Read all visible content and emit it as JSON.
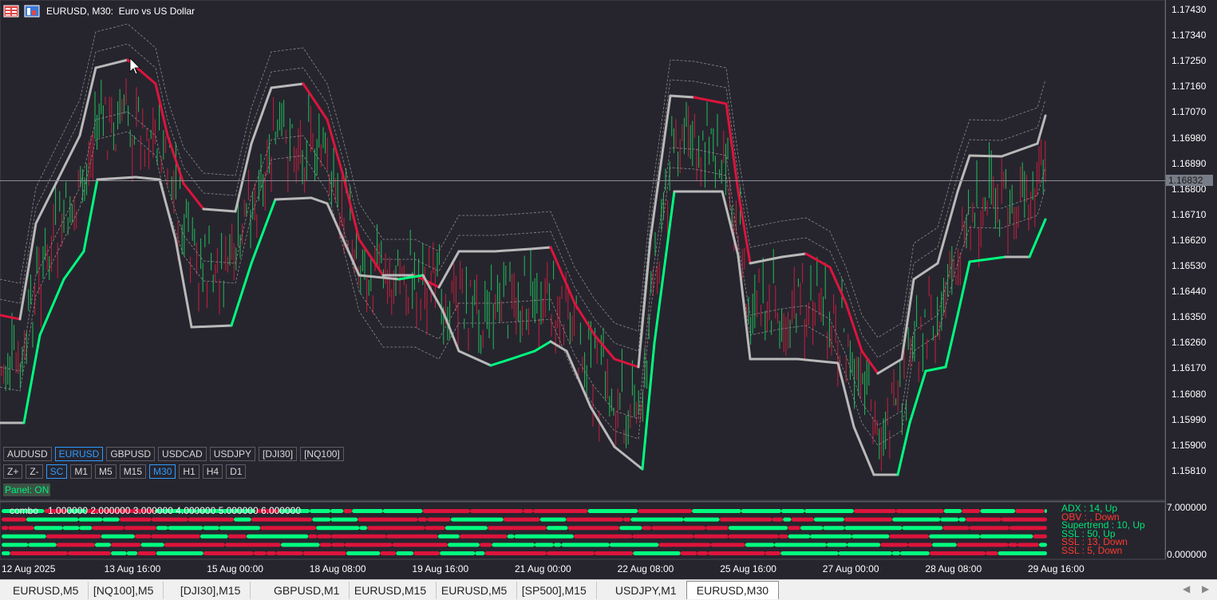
{
  "header": {
    "title": "EURUSD, M30:  Euro vs US Dollar",
    "icons": [
      "grid-icon",
      "one-click-trading-icon"
    ]
  },
  "price_axis": [
    "1.17430",
    "1.17340",
    "1.17250",
    "1.17160",
    "1.17070",
    "1.16980",
    "1.16890",
    "1.16800",
    "1.16710",
    "1.16620",
    "1.16530",
    "1.16440",
    "1.16350",
    "1.16260",
    "1.16170",
    "1.16080",
    "1.15990",
    "1.15900",
    "1.15810"
  ],
  "current_price": "1.16832",
  "time_axis": [
    "12 Aug 2025",
    "13 Aug 16:00",
    "15 Aug 00:00",
    "18 Aug 08:00",
    "19 Aug 16:00",
    "21 Aug 00:00",
    "22 Aug 08:00",
    "25 Aug 16:00",
    "27 Aug 00:00",
    "28 Aug 08:00",
    "29 Aug 16:00"
  ],
  "panel": {
    "symbols": [
      "AUDUSD",
      "EURUSD",
      "GBPUSD",
      "USDCAD",
      "USDJPY",
      "[DJI30]",
      "[NQ100]"
    ],
    "active_symbol": "EURUSD",
    "controls": [
      "Z+",
      "Z-",
      "SC"
    ],
    "timeframes": [
      "M1",
      "M5",
      "M15",
      "M30",
      "H1",
      "H4",
      "D1"
    ],
    "active_timeframe": "M30",
    "status": "Panel: ON"
  },
  "subwindow": {
    "name": "combo",
    "levels": "1.000000 2.000000 3.000000 4.000000 5.000000 6.000000",
    "scale_max": "7.000000",
    "scale_min": "0.000000",
    "signals": [
      {
        "text": "ADX : 14, Up",
        "color": "#00e676"
      },
      {
        "text": "OBV :  , Down",
        "color": "#ff3b30"
      },
      {
        "text": "Supertrend : 10, Up",
        "color": "#00e676"
      },
      {
        "text": "SSL : 50, Up",
        "color": "#00e676"
      },
      {
        "text": "SSL : 13, Down",
        "color": "#ff3b30"
      },
      {
        "text": "SSL : 5, Down",
        "color": "#ff3b30"
      }
    ]
  },
  "tabs": [
    "EURUSD,M5",
    "[NQ100],M5",
    "[DJI30],M15",
    "GBPUSD,M1",
    "EURUSD,M15",
    "EURUSD,M5",
    "[SP500],M15",
    "USDJPY,M1",
    "EURUSD,M30"
  ],
  "active_tab": "EURUSD,M30",
  "colors": {
    "background": "#26252e",
    "bull": "#00ff7f",
    "bear": "#dc143c",
    "neutral": "#b9b9b9",
    "accent": "#2f9bff"
  }
}
